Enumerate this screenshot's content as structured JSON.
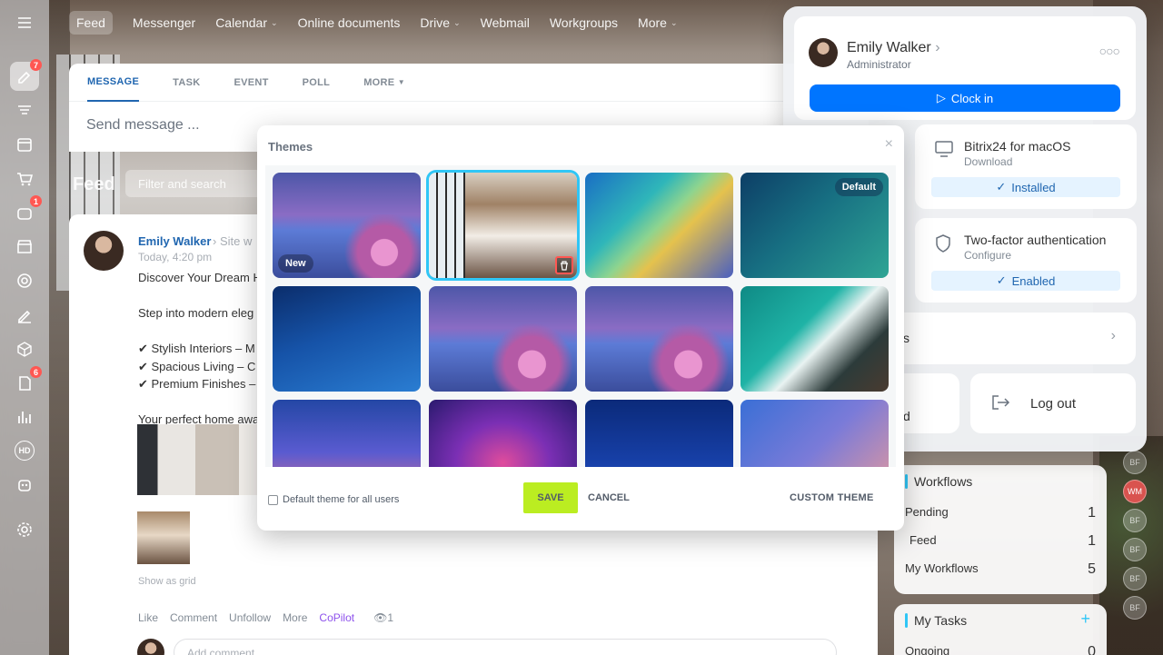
{
  "topnav": {
    "items": [
      {
        "label": "Feed"
      },
      {
        "label": "Messenger"
      },
      {
        "label": "Calendar"
      },
      {
        "label": "Online documents"
      },
      {
        "label": "Drive"
      },
      {
        "label": "Webmail"
      },
      {
        "label": "Workgroups"
      },
      {
        "label": "More"
      }
    ]
  },
  "rail": {
    "badges": {
      "feed": "7",
      "tasks": "1",
      "docs": "6"
    },
    "hd_label": "HD"
  },
  "composer": {
    "tabs": [
      "MESSAGE",
      "TASK",
      "EVENT",
      "POLL",
      "MORE"
    ],
    "placeholder": "Send message ..."
  },
  "feed": {
    "label": "Feed",
    "filter_placeholder": "Filter and search"
  },
  "post": {
    "author": "Emily Walker",
    "destination": "Site w",
    "time": "Today, 4:20 pm",
    "lines": [
      "Discover Your Dream H",
      "",
      "Step into modern eleg",
      "",
      "✔ Stylish Interiors – M",
      "✔ Spacious Living – C",
      "✔ Premium Finishes –",
      "",
      "Your perfect home awa"
    ],
    "show_as_grid": "Show as grid",
    "actions": {
      "like": "Like",
      "comment": "Comment",
      "unfollow": "Unfollow",
      "more": "More",
      "copilot": "CoPilot",
      "views": "1"
    },
    "comment_placeholder": "Add comment"
  },
  "profile": {
    "name": "Emily Walker",
    "role": "Administrator",
    "clock_in": "Clock in",
    "apps": [
      {
        "title": "Bitrix24 for macOS",
        "sub": "Download",
        "status": "Installed"
      },
      {
        "title": "Two-factor authentication",
        "sub": "Configure",
        "status": "Enabled"
      }
    ],
    "row_partial": "s",
    "partial_left": "d",
    "logout": "Log out"
  },
  "workflows": {
    "title": "Workflows",
    "rows": [
      {
        "label": "Pending",
        "value": "1"
      },
      {
        "label": "Feed",
        "value": "1"
      },
      {
        "label": "My Workflows",
        "value": "5"
      }
    ]
  },
  "tasks": {
    "title": "My Tasks",
    "rows": [
      {
        "label": "Ongoing",
        "value": "0"
      }
    ]
  },
  "side_avatars": [
    "BF",
    "WM",
    "BF",
    "BF",
    "BF",
    "BF"
  ],
  "themes": {
    "title": "Themes",
    "badges": {
      "new": "New",
      "default": "Default"
    },
    "tiles": [
      {
        "kind": "flowers",
        "badge": "new"
      },
      {
        "kind": "room",
        "selected": true
      },
      {
        "kind": "aurora"
      },
      {
        "kind": "teal",
        "badge": "default"
      },
      {
        "kind": "blue-wave"
      },
      {
        "kind": "flowers"
      },
      {
        "kind": "flowers"
      },
      {
        "kind": "ocean"
      },
      {
        "kind": "blue-pink"
      },
      {
        "kind": "purple-pink"
      },
      {
        "kind": "navy"
      },
      {
        "kind": "blue-coral"
      }
    ],
    "checkbox_label": "Default theme for all users",
    "save": "SAVE",
    "cancel": "CANCEL",
    "custom": "CUSTOM THEME"
  },
  "colors": {
    "accent": "#0075ff",
    "link": "#2066b0",
    "save_btn": "#bbed21",
    "selection": "#2fc6f6",
    "badge": "#ff5752"
  }
}
